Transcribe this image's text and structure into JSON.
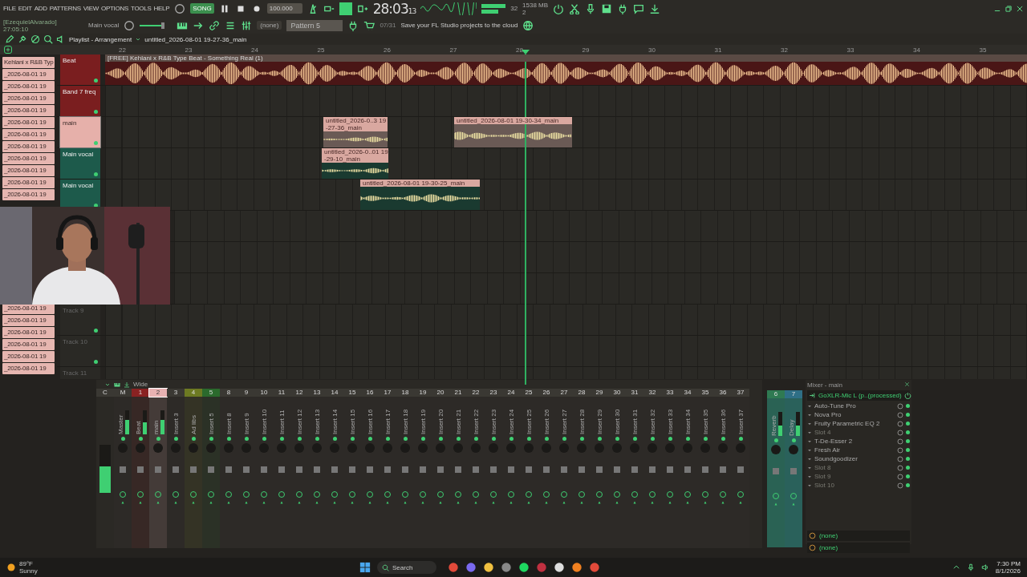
{
  "menu": [
    "FILE",
    "EDIT",
    "ADD",
    "PATTERNS",
    "VIEW",
    "OPTIONS",
    "TOOLS",
    "HELP"
  ],
  "transport": {
    "master_volume": {
      "level": 0.75
    },
    "mode": "SONG",
    "tempo": "100.000",
    "time": "28:03",
    "time_small": "13",
    "cpu": "32",
    "memory": "1538 MB",
    "polyphony": "2",
    "channel": "(none)",
    "pattern": "Pattern 5"
  },
  "hint": {
    "title": "[EzequielAlvarado]",
    "time": "27:05:10",
    "label": "Main vocal"
  },
  "news": {
    "date": "07/31",
    "text": "Save your FL Studio projects to the cloud"
  },
  "playlist": {
    "title": "Playlist - Arrangement",
    "project": "untitled_2026-08-01 19-27-36_main",
    "ruler": [
      "22",
      "23",
      "24",
      "25",
      "26",
      "27",
      "28",
      "29",
      "30",
      "31",
      "32",
      "33",
      "34",
      "35"
    ]
  },
  "pattern_list_top": [
    "Kehlani x R&B Typ",
    "_2026-08-01 19",
    "_2026-08-01 19",
    "_2026-08-01 19",
    "_2026-08-01 19",
    "_2026-08-01 19",
    "_2026-08-01 19",
    "_2026-08-01 19",
    "_2026-08-01 19",
    "_2026-08-01 19",
    "_2026-08-01 19",
    "_2026-08-01 19"
  ],
  "pattern_list_bottom": [
    "_2026-08-01 19",
    "_2026-08-01 19",
    "_2026-08-01 19",
    "_2026-08-01 19",
    "_2026-08-01 19",
    "_2026-08-01 19"
  ],
  "tracks_top": [
    {
      "name": "Beat",
      "color": "#7a1e1f",
      "selected": false,
      "clips": [
        {
          "title": "[FREE] Kehlani x R&B Type Beat - Something Real (1)"
        }
      ]
    },
    {
      "name": "Band 7 freq",
      "color": "#7a1e1f",
      "selected": false
    },
    {
      "name": "main",
      "color": "#e6b0aa",
      "selected": true,
      "clips": [
        {
          "title": "untitled_2026-0..3 19-27-36_main"
        },
        {
          "title": "untitled_2026-08-01 19-30-34_main"
        }
      ]
    },
    {
      "name": "Main vocal",
      "color": "#1d5a4b",
      "selected": false,
      "clips": [
        {
          "title": "untitled_2026-0..01 19-29-10_main"
        }
      ]
    },
    {
      "name": "Main vocal",
      "color": "#1d5a4b",
      "selected": false,
      "clips": [
        {
          "title": "untitled_2026-08-01 19-30-25_main"
        }
      ]
    }
  ],
  "tracks_bottom": [
    {
      "name": "Track 9"
    },
    {
      "name": "Track 10"
    },
    {
      "name": "Track 11"
    }
  ],
  "mixer": {
    "mode": "Wide",
    "master": {
      "label": "C",
      "level": 0.55
    },
    "strips": [
      {
        "num": "M",
        "name": "Master",
        "color": "#3a3833",
        "selected": false,
        "level": 0.6
      },
      {
        "num": "1",
        "name": "Beat",
        "color": "#8a2222",
        "selected": false,
        "level": 0.5
      },
      {
        "num": "2",
        "name": "main",
        "color": "#e8b2b2",
        "selected": true,
        "level": 0.6
      },
      {
        "num": "3",
        "name": "Insert 3",
        "color": "#3a3833",
        "selected": false
      },
      {
        "num": "4",
        "name": "Ad libs",
        "color": "#6d7a22",
        "selected": false
      },
      {
        "num": "5",
        "name": "Insert 5",
        "color": "#2b6a2d",
        "selected": false
      },
      {
        "num": "8",
        "name": "Insert 8",
        "color": "#3a3833",
        "selected": false
      },
      {
        "num": "9",
        "name": "Insert 9",
        "color": "#3a3833",
        "selected": false
      },
      {
        "num": "10",
        "name": "Insert 10",
        "color": "#3a3833",
        "selected": false
      },
      {
        "num": "11",
        "name": "Insert 11",
        "color": "#3a3833",
        "selected": false
      },
      {
        "num": "12",
        "name": "Insert 12",
        "color": "#3a3833",
        "selected": false
      },
      {
        "num": "13",
        "name": "Insert 13",
        "color": "#3a3833",
        "selected": false
      },
      {
        "num": "14",
        "name": "Insert 14",
        "color": "#3a3833",
        "selected": false
      },
      {
        "num": "15",
        "name": "Insert 15",
        "color": "#3a3833",
        "selected": false
      },
      {
        "num": "16",
        "name": "Insert 16",
        "color": "#3a3833",
        "selected": false
      },
      {
        "num": "17",
        "name": "Insert 17",
        "color": "#3a3833",
        "selected": false
      },
      {
        "num": "18",
        "name": "Insert 18",
        "color": "#3a3833",
        "selected": false
      },
      {
        "num": "19",
        "name": "Insert 19",
        "color": "#3a3833",
        "selected": false
      },
      {
        "num": "20",
        "name": "Insert 20",
        "color": "#3a3833",
        "selected": false
      },
      {
        "num": "21",
        "name": "Insert 21",
        "color": "#3a3833",
        "selected": false
      },
      {
        "num": "22",
        "name": "Insert 22",
        "color": "#3a3833",
        "selected": false
      },
      {
        "num": "23",
        "name": "Insert 23",
        "color": "#3a3833",
        "selected": false
      },
      {
        "num": "24",
        "name": "Insert 24",
        "color": "#3a3833",
        "selected": false
      },
      {
        "num": "25",
        "name": "Insert 25",
        "color": "#3a3833",
        "selected": false
      },
      {
        "num": "26",
        "name": "Insert 26",
        "color": "#3a3833",
        "selected": false
      },
      {
        "num": "27",
        "name": "Insert 27",
        "color": "#3a3833",
        "selected": false
      },
      {
        "num": "28",
        "name": "Insert 28",
        "color": "#3a3833",
        "selected": false
      },
      {
        "num": "29",
        "name": "Insert 29",
        "color": "#3a3833",
        "selected": false
      },
      {
        "num": "30",
        "name": "Insert 30",
        "color": "#3a3833",
        "selected": false
      },
      {
        "num": "31",
        "name": "Insert 31",
        "color": "#3a3833",
        "selected": false
      },
      {
        "num": "32",
        "name": "Insert 32",
        "color": "#3a3833",
        "selected": false
      },
      {
        "num": "33",
        "name": "Insert 33",
        "color": "#3a3833",
        "selected": false
      },
      {
        "num": "34",
        "name": "Insert 34",
        "color": "#3a3833",
        "selected": false
      },
      {
        "num": "35",
        "name": "Insert 35",
        "color": "#3a3833",
        "selected": false
      },
      {
        "num": "36",
        "name": "Insert 36",
        "color": "#3a3833",
        "selected": false
      },
      {
        "num": "37",
        "name": "Insert 37",
        "color": "#3a3833",
        "selected": false
      }
    ],
    "docked": [
      {
        "num": "6",
        "name": "Reverb",
        "color": "#2f7a52",
        "selected": false,
        "level": 0.45
      },
      {
        "num": "7",
        "name": "Delay",
        "color": "#2f6f86",
        "selected": false,
        "level": 0.45
      }
    ]
  },
  "mixer_panel": {
    "title": "Mixer - main",
    "input": "GoXLR-Mic L (p..(processed)",
    "slots": [
      {
        "name": "Auto-Tune Pro",
        "kind": "plugin"
      },
      {
        "name": "Nova Pro",
        "kind": "plugin"
      },
      {
        "name": "Fruity Parametric EQ 2",
        "kind": "plugin"
      },
      {
        "name": "Slot 4",
        "kind": "empty"
      },
      {
        "name": "T-De-Esser 2",
        "kind": "plugin"
      },
      {
        "name": "Fresh Air",
        "kind": "plugin"
      },
      {
        "name": "Soundgoodizer",
        "kind": "plugin"
      },
      {
        "name": "Slot 8",
        "kind": "empty"
      },
      {
        "name": "Slot 9",
        "kind": "empty"
      },
      {
        "name": "Slot 10",
        "kind": "empty"
      }
    ],
    "outputs": [
      "(none)",
      "(none)"
    ]
  },
  "taskbar": {
    "temperature": "89°F",
    "weather": "Sunny",
    "search": "Search",
    "time": "7:30 PM",
    "date": "8/1/2026"
  }
}
